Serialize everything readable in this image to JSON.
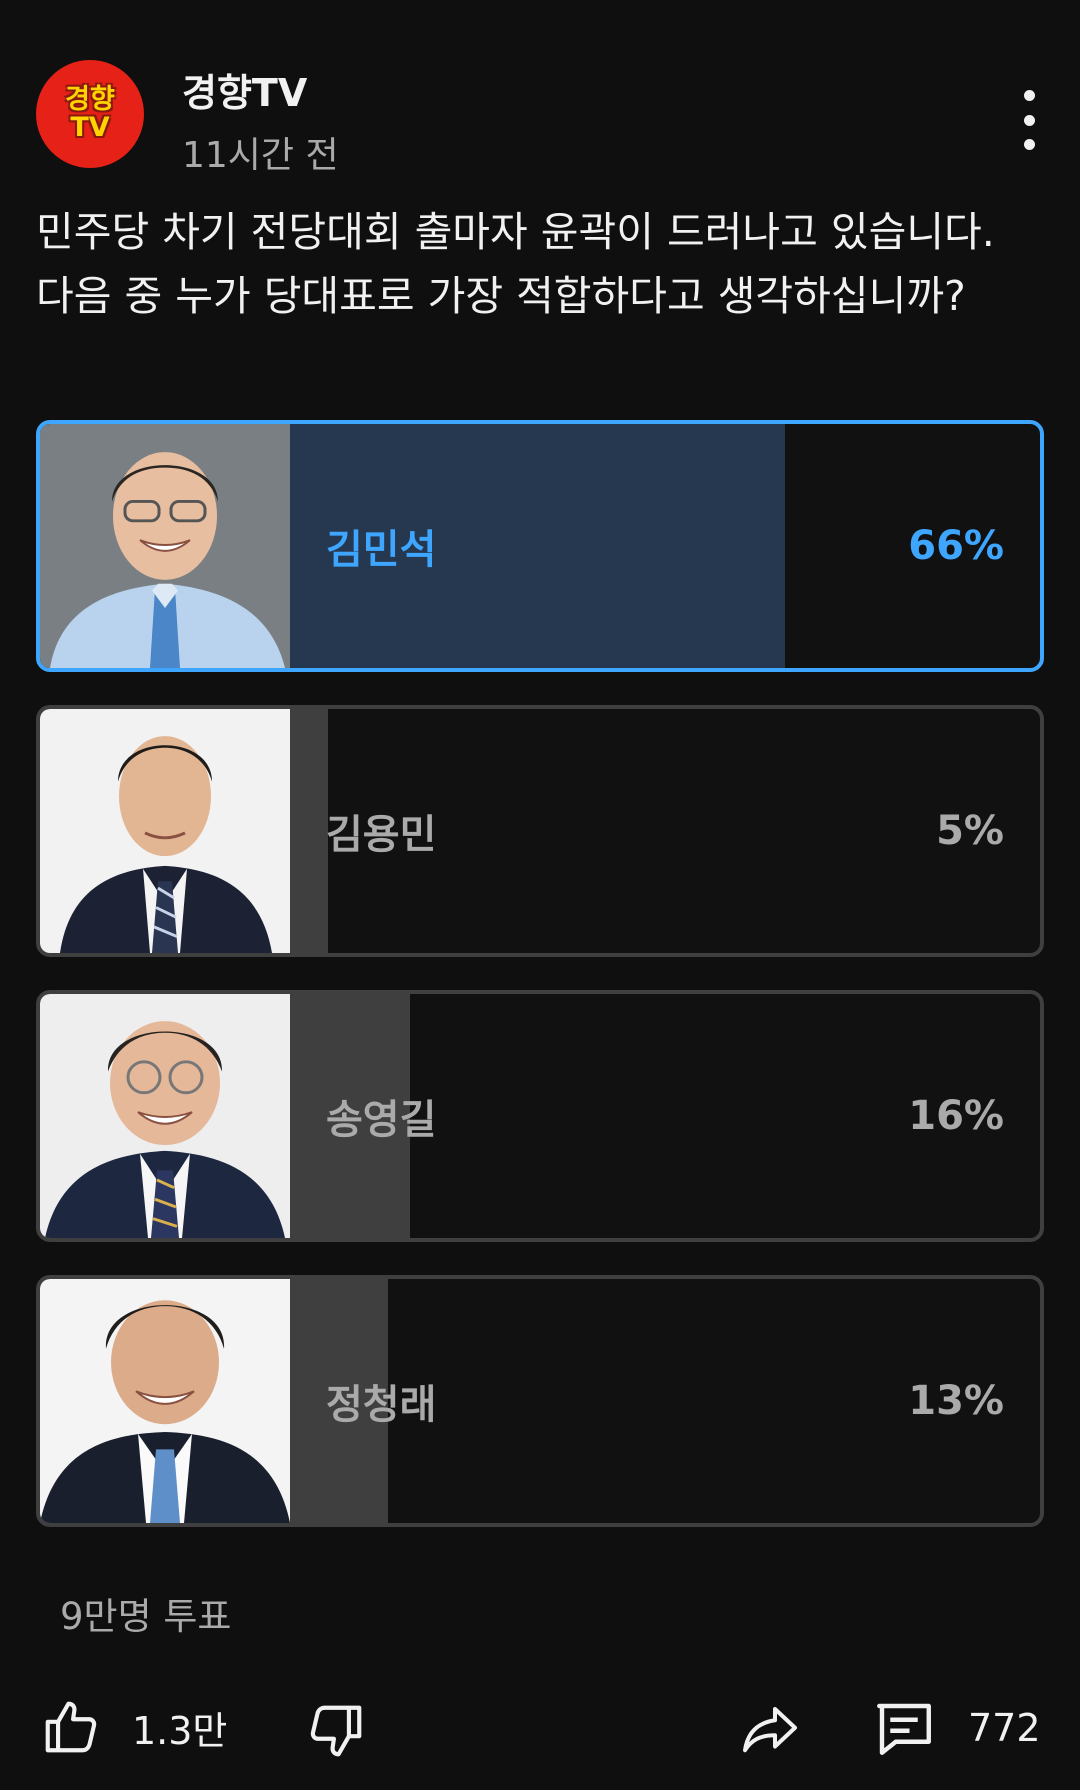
{
  "channel": {
    "name": "경향TV",
    "avatar_text_top": "경향",
    "avatar_text_bottom": "TV",
    "time": "11시간 전"
  },
  "question": "민주당 차기 전당대회 출마자 윤곽이 드러나고 있습니다. 다음 중 누가 당대표로 가장 적합하다고 생각하십니까?",
  "poll": {
    "options": [
      {
        "name": "김민석",
        "percent_label": "66%",
        "percent": 66,
        "selected": true
      },
      {
        "name": "김용민",
        "percent_label": "5%",
        "percent": 5,
        "selected": false
      },
      {
        "name": "송영길",
        "percent_label": "16%",
        "percent": 16,
        "selected": false
      },
      {
        "name": "정청래",
        "percent_label": "13%",
        "percent": 13,
        "selected": false
      }
    ],
    "vote_count": "9만명 투표"
  },
  "actions": {
    "like_count": "1.3만",
    "comment_count": "772"
  },
  "colors": {
    "background": "#0f0f0f",
    "accent": "#3ea6ff",
    "selected_fill": "#263850",
    "unselected_fill": "#3f3f3f",
    "secondary_text": "#aaaaaa"
  },
  "icons": [
    "more-vert-icon",
    "thumb-up-icon",
    "thumb-down-icon",
    "share-icon",
    "comment-icon"
  ]
}
